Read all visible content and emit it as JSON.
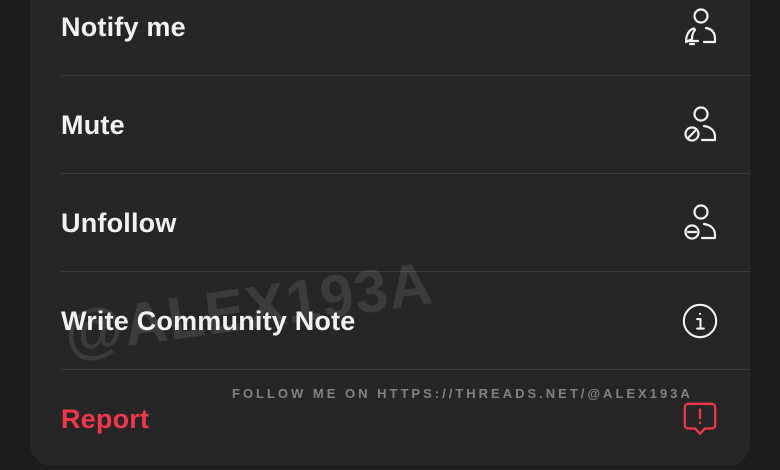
{
  "menu": {
    "items": [
      {
        "label": "Notify me",
        "icon": "person-bell-icon"
      },
      {
        "label": "Mute",
        "icon": "person-mute-icon"
      },
      {
        "label": "Unfollow",
        "icon": "person-minus-icon"
      },
      {
        "label": "Write Community Note",
        "icon": "info-circle-icon"
      },
      {
        "label": "Report",
        "icon": "report-alert-icon"
      }
    ]
  },
  "watermark": {
    "handle": "@ALEX193A",
    "follow_text": "FOLLOW ME ON HTTPS://THREADS.NET/@ALEX193A"
  },
  "colors": {
    "sheet_background": "#262626",
    "text": "#f2f2f2",
    "danger": "#f0374b",
    "divider": "#3c3c3c"
  }
}
